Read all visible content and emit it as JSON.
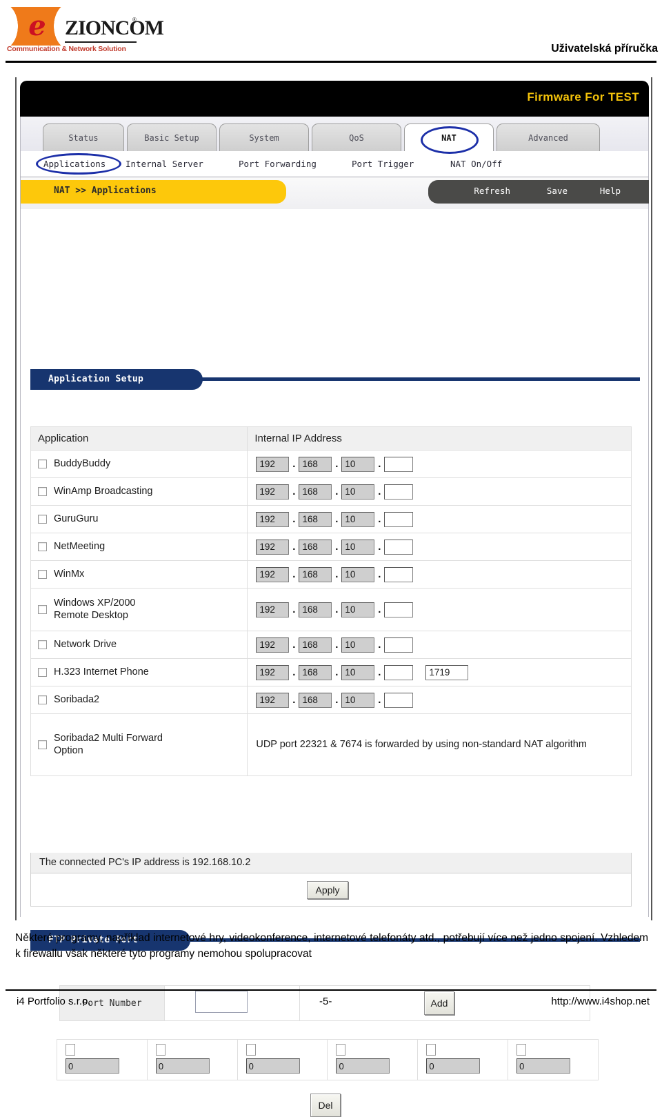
{
  "document": {
    "header_title": "Uživatelská příručka",
    "caption": "Některé programy, například internetové hry, videokonference, internetové telefonáty atd., potřebují více než jedno spojení. Vzhledem k firewallu však některé tyto programy nemohou spolupracovat",
    "footer": {
      "company": "i4 Portfolio s.r.o.",
      "page_number": "-5-",
      "website": "http://www.i4shop.net"
    }
  },
  "logo": {
    "letter": "e",
    "wordmark": "ZIONCOM",
    "registered": "®",
    "tagline": "Communication & Network Solution"
  },
  "router": {
    "firmware_label": "Firmware For TEST",
    "tabs": [
      {
        "label": "Status",
        "active": false
      },
      {
        "label": "Basic Setup",
        "active": false
      },
      {
        "label": "System",
        "active": false
      },
      {
        "label": "QoS",
        "active": false
      },
      {
        "label": "NAT",
        "active": true
      },
      {
        "label": "Advanced",
        "active": false
      }
    ],
    "subtabs": [
      {
        "label": "Applications",
        "active": true
      },
      {
        "label": "Internal Server",
        "active": false
      },
      {
        "label": "Port Forwarding",
        "active": false
      },
      {
        "label": "Port Trigger",
        "active": false
      },
      {
        "label": "NAT On/Off",
        "active": false
      }
    ],
    "breadcrumb": "NAT >> Applications",
    "toolbar": [
      {
        "label": "Refresh"
      },
      {
        "label": "Save"
      },
      {
        "label": "Help"
      }
    ],
    "sections": {
      "application_setup": "Application Setup",
      "ftp_private_port": "FTP Private Port"
    },
    "app_table": {
      "headers": {
        "application": "Application",
        "internal_ip": "Internal IP Address"
      },
      "rows": [
        {
          "name": "BuddyBuddy",
          "checked": false,
          "octets": [
            "192",
            "168",
            "10",
            ""
          ],
          "extra_port": null
        },
        {
          "name": "WinAmp Broadcasting",
          "checked": false,
          "octets": [
            "192",
            "168",
            "10",
            ""
          ],
          "extra_port": null
        },
        {
          "name": "GuruGuru",
          "checked": false,
          "octets": [
            "192",
            "168",
            "10",
            ""
          ],
          "extra_port": null
        },
        {
          "name": "NetMeeting",
          "checked": false,
          "octets": [
            "192",
            "168",
            "10",
            ""
          ],
          "extra_port": null
        },
        {
          "name": "WinMx",
          "checked": false,
          "octets": [
            "192",
            "168",
            "10",
            ""
          ],
          "extra_port": null
        },
        {
          "name": "Windows XP/2000\nRemote Desktop",
          "checked": false,
          "octets": [
            "192",
            "168",
            "10",
            ""
          ],
          "extra_port": null
        },
        {
          "name": "Network Drive",
          "checked": false,
          "octets": [
            "192",
            "168",
            "10",
            ""
          ],
          "extra_port": null
        },
        {
          "name": "H.323 Internet Phone",
          "checked": false,
          "octets": [
            "192",
            "168",
            "10",
            ""
          ],
          "extra_port": "1719"
        },
        {
          "name": "Soribada2",
          "checked": false,
          "octets": [
            "192",
            "168",
            "10",
            ""
          ],
          "extra_port": null
        },
        {
          "name": "Soribada2 Multi Forward\nOption",
          "checked": false,
          "octets": null,
          "extra_port": null,
          "note": "UDP port 22321 & 7674 is forwarded by using non-standard NAT algorithm"
        }
      ],
      "connected_pc_note": "The connected PC's IP address is 192.168.10.2",
      "apply_label": "Apply"
    },
    "ftp": {
      "port_number_label": "Port Number",
      "port_number_value": "",
      "add_label": "Add",
      "del_label": "Del",
      "ports": [
        {
          "checked": false,
          "value": "0"
        },
        {
          "checked": false,
          "value": "0"
        },
        {
          "checked": false,
          "value": "0"
        },
        {
          "checked": false,
          "value": "0"
        },
        {
          "checked": false,
          "value": "0"
        },
        {
          "checked": false,
          "value": "0"
        }
      ]
    }
  },
  "colors": {
    "brand_orange": "#ef7a1a",
    "brand_red": "#cc1122",
    "accent_yellow": "#fdc80b",
    "section_blue": "#17356f",
    "highlight_blue": "#1c2fa8",
    "toolbar_gray": "#4a4a48",
    "firmware_yellow": "#f3c20a"
  }
}
